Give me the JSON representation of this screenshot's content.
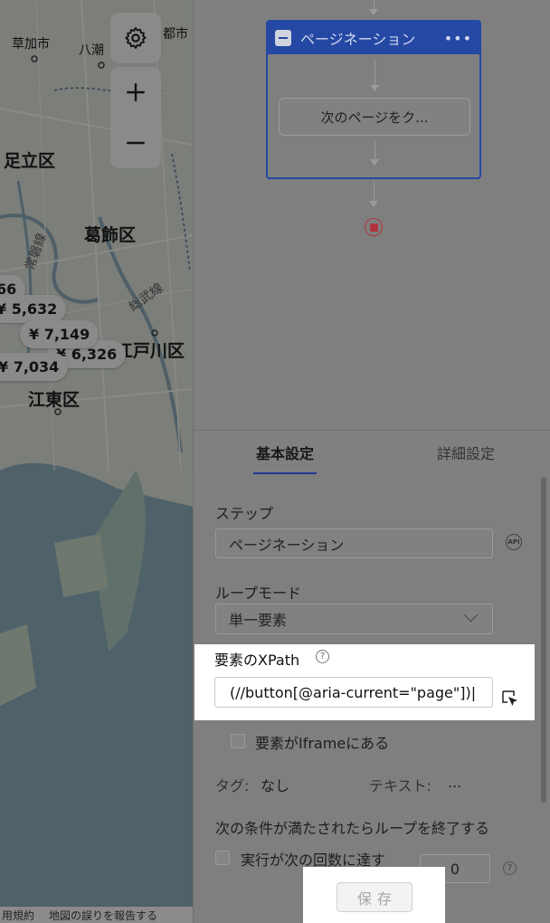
{
  "map": {
    "wards": [
      "足立区",
      "葛飾区",
      "江戸川区",
      "江東区"
    ],
    "towns": [
      "草加市",
      "八潮",
      "都市"
    ],
    "rail_lines": [
      "常磐線",
      "総武線"
    ],
    "prices": [
      "66",
      "¥ 5,632",
      "¥ 7,149",
      "¥ 6,326",
      "¥ 7,034"
    ],
    "footer": {
      "terms": "用規約",
      "report": "地図の誤りを報告する"
    }
  },
  "flow": {
    "block_title": "ページネーション",
    "block_menu": "•••",
    "step_label": "次のページをク..."
  },
  "tabs": [
    {
      "label": "基本設定",
      "active": true
    },
    {
      "label": "詳細設定",
      "active": false
    }
  ],
  "form": {
    "step_label": "ステップ",
    "step_value": "ページネーション",
    "api_badge": "API",
    "loop_mode_label": "ループモード",
    "loop_mode_value": "単一要素",
    "xpath_label": "要素のXPath",
    "help_glyph": "?",
    "xpath_value": "(//button[@aria-current=\"page\"])|",
    "iframe_label": "要素がIframeにある",
    "tag_label": "タグ:",
    "tag_value": "なし",
    "text_label": "テキスト:",
    "text_value": "...",
    "exit_condition_label": "次の条件が満たされたらループを終了する",
    "exec_count_label": "実行が次の回数に達す",
    "exec_count_value": "0"
  },
  "save_label": "保存",
  "colors": {
    "accent": "#24399a",
    "stop": "#b3343c"
  }
}
